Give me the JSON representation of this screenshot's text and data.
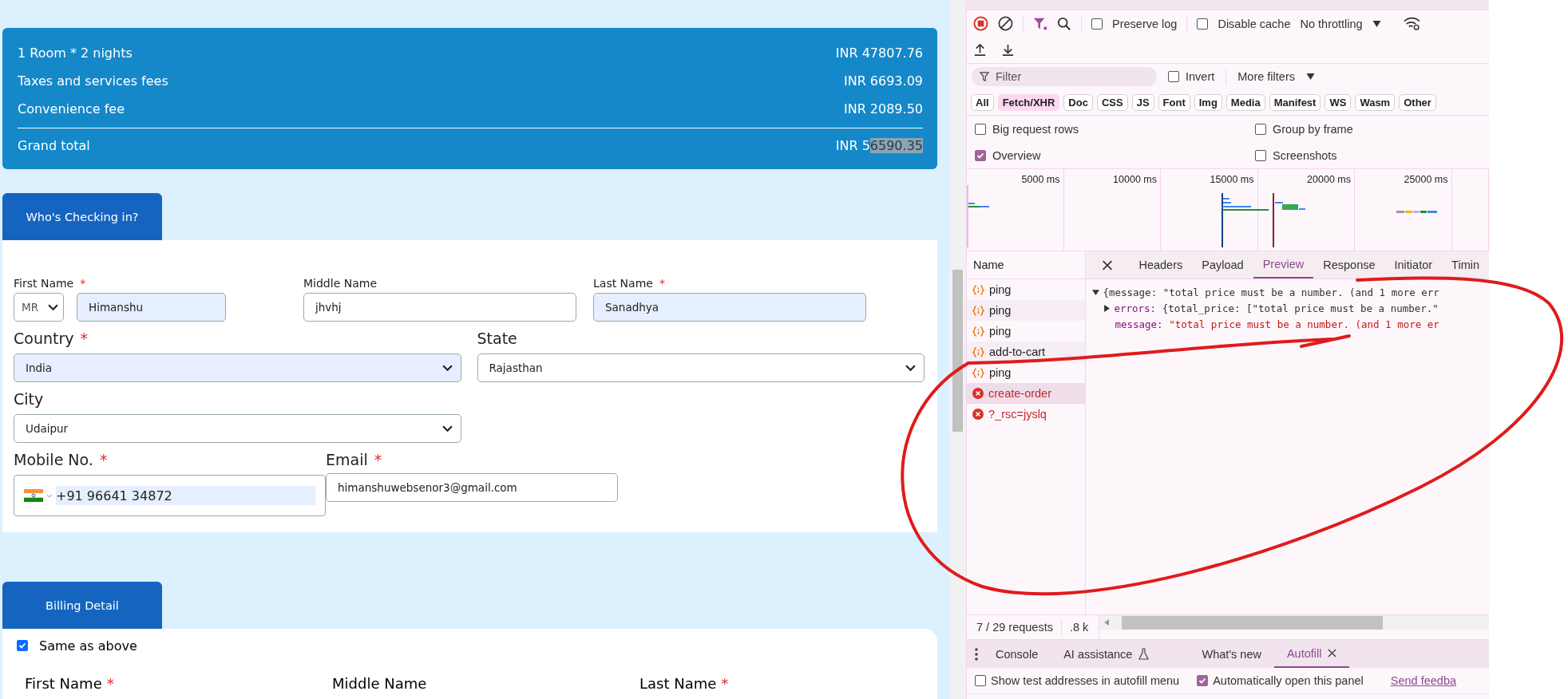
{
  "summary": {
    "rows": [
      {
        "label": "1 Room * 2 nights",
        "amount": "INR 47807.76"
      },
      {
        "label": "Taxes and services fees",
        "amount": "INR 6693.09"
      },
      {
        "label": "Convenience fee",
        "amount": "INR 2089.50"
      }
    ],
    "total": {
      "label": "Grand total",
      "amount_prefix": "INR 5",
      "amount_selected": "6590.35"
    }
  },
  "checkin": {
    "tab": "Who's Checking in?",
    "first_name": {
      "label": "First Name",
      "mark": "*",
      "salutation": "MR",
      "value": "Himanshu",
      "autofilled": true
    },
    "middle_name": {
      "label": "Middle Name",
      "value": "jhvhj",
      "autofilled": false
    },
    "last_name": {
      "label": "Last Name",
      "mark": "*",
      "value": "Sanadhya",
      "autofilled": true
    },
    "country": {
      "label": "Country",
      "mark": "*",
      "value": "India",
      "autofilled": true
    },
    "state": {
      "label": "State",
      "value": "Rajasthan",
      "autofilled": false
    },
    "city": {
      "label": "City",
      "value": "Udaipur",
      "autofilled": false
    },
    "mobile": {
      "label": "Mobile No.",
      "mark": "*",
      "value": "+91 96641 34872",
      "autofilled": true
    },
    "email": {
      "label": "Email",
      "mark": "*",
      "value": "himanshuwebsenor3@gmail.com",
      "autofilled": false
    }
  },
  "billing": {
    "tab": "Billing Detail",
    "same_as_above": {
      "label": "Same as above",
      "checked": true
    },
    "labels": [
      {
        "label": "First Name",
        "mark": "*"
      },
      {
        "label": "Middle Name"
      },
      {
        "label": "Last Name",
        "mark": "*"
      }
    ]
  },
  "devtools": {
    "toolbar": {
      "preserve_log": {
        "label": "Preserve log",
        "checked": false
      },
      "disable_cache": {
        "label": "Disable cache",
        "checked": false
      },
      "throttling": "No throttling"
    },
    "filter": {
      "placeholder": "Filter",
      "invert": {
        "label": "Invert",
        "checked": false
      },
      "more_filters": "More filters"
    },
    "type_filters": [
      {
        "label": "All",
        "selected": false
      },
      {
        "label": "Fetch/XHR",
        "selected": true
      },
      {
        "label": "Doc",
        "selected": false
      },
      {
        "label": "CSS",
        "selected": false
      },
      {
        "label": "JS",
        "selected": false
      },
      {
        "label": "Font",
        "selected": false
      },
      {
        "label": "Img",
        "selected": false
      },
      {
        "label": "Media",
        "selected": false
      },
      {
        "label": "Manifest",
        "selected": false
      },
      {
        "label": "WS",
        "selected": false
      },
      {
        "label": "Wasm",
        "selected": false
      },
      {
        "label": "Other",
        "selected": false
      }
    ],
    "options": [
      {
        "label": "Big request rows",
        "checked": false
      },
      {
        "label": "Group by frame",
        "checked": false
      },
      {
        "label": "Overview",
        "checked": true
      },
      {
        "label": "Screenshots",
        "checked": false
      }
    ],
    "timeline_ticks": [
      "5000 ms",
      "10000 ms",
      "15000 ms",
      "20000 ms",
      "25000 ms"
    ],
    "requests": {
      "header": "Name",
      "items": [
        {
          "name": "ping",
          "kind": "fetch",
          "selected": false
        },
        {
          "name": "ping",
          "kind": "fetch",
          "selected": false
        },
        {
          "name": "ping",
          "kind": "fetch",
          "selected": false
        },
        {
          "name": "add-to-cart",
          "kind": "fetch",
          "selected": false
        },
        {
          "name": "ping",
          "kind": "fetch",
          "selected": false
        },
        {
          "name": "create-order",
          "kind": "error",
          "selected": true
        },
        {
          "name": "?_rsc=jyslq",
          "kind": "error",
          "selected": false
        }
      ]
    },
    "detail_tabs": [
      {
        "label": "Headers",
        "selected": false
      },
      {
        "label": "Payload",
        "selected": false
      },
      {
        "label": "Preview",
        "selected": true
      },
      {
        "label": "Response",
        "selected": false
      },
      {
        "label": "Initiator",
        "selected": false
      },
      {
        "label": "Timin",
        "selected": false
      }
    ],
    "preview": [
      {
        "kind": "object",
        "expanded": true,
        "text": "{message: \"total price must be a number. (and 1 more err"
      },
      {
        "kind": "property",
        "expanded": false,
        "key": "errors:",
        "value": "{total_price: [\"total price must be a number.\""
      },
      {
        "kind": "string",
        "key": "message:",
        "value": "\"total price must be a number. (and 1 more er"
      }
    ],
    "footer": {
      "requests": "7 / 29 requests",
      "transferred": ".8 k"
    },
    "drawer_tabs": [
      {
        "label": "Console",
        "selected": false,
        "kind": "plain"
      },
      {
        "label": "AI assistance",
        "selected": false,
        "kind": "experimental"
      },
      {
        "label": "What's new",
        "selected": false,
        "kind": "plain"
      },
      {
        "label": "Autofill",
        "selected": true,
        "kind": "closable"
      }
    ],
    "autofill": {
      "show_test": {
        "label": "Show test addresses in autofill menu",
        "checked": false
      },
      "auto_open": {
        "label": "Automatically open this panel",
        "checked": true
      },
      "feedback": "Send feedba"
    }
  }
}
